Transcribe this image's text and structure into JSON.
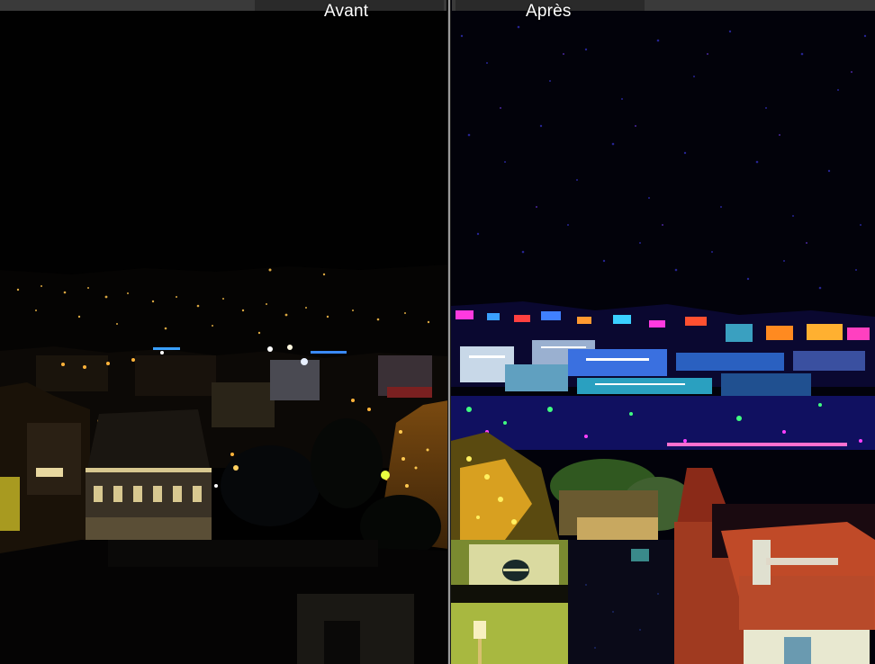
{
  "viewer": {
    "before_label": "Avant",
    "after_label": "Après",
    "divider_icon": "split-view-handle-icon"
  },
  "colors": {
    "title_strip": "#3a3a3a",
    "title_tab": "#2a2a2a",
    "divider": "#9a9a9a",
    "label_text": "#ffffff"
  }
}
